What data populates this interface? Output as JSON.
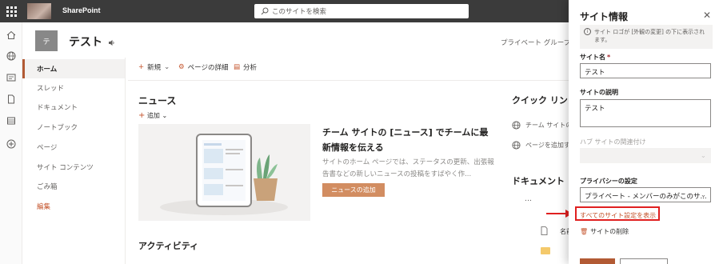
{
  "topbar": {
    "app_name": "SharePoint",
    "search_placeholder": "このサイトを検索"
  },
  "site": {
    "logo_letter": "テ",
    "title": "テスト",
    "type_label": "プライベート グループ"
  },
  "leftnav": {
    "items": [
      {
        "label": "ホーム"
      },
      {
        "label": "スレッド"
      },
      {
        "label": "ドキュメント"
      },
      {
        "label": "ノートブック"
      },
      {
        "label": "ページ"
      },
      {
        "label": "サイト コンテンツ"
      },
      {
        "label": "ごみ箱"
      },
      {
        "label": "編集"
      }
    ]
  },
  "commandbar": {
    "new_label": "新規",
    "page_details_label": "ページの詳細",
    "analytics_label": "分析"
  },
  "news": {
    "title": "ニュース",
    "add_label": "追加",
    "headline": "チーム サイトの [ニュース] でチームに最新情報を伝える",
    "body": "サイトのホーム ページでは、ステータスの更新、出張報告書などの新しいニュースの投稿をすばやく作...",
    "button_label": "ニュースの追加"
  },
  "activity": {
    "title": "アクティビティ"
  },
  "quicklinks": {
    "title": "クイック リン",
    "items": [
      {
        "label": "チーム サイトの"
      },
      {
        "label": "ページを追加す"
      }
    ]
  },
  "documents": {
    "title": "ドキュメント",
    "more": "…",
    "column_label": "名前"
  },
  "panel": {
    "title": "サイト情報",
    "info_text": "サイト ロゴが [外観の変更] の下に表示されます。",
    "site_name_label": "サイト名",
    "site_name_required": "*",
    "site_name_value": "テスト",
    "description_label": "サイトの説明",
    "description_value": "テスト",
    "hub_label": "ハブ サイトの関連付け",
    "privacy_label": "プライバシーの設定",
    "privacy_value": "プライベート - メンバーのみがこのサ...",
    "all_settings_link": "すべてのサイト設定を表示",
    "delete_label": "サイトの削除"
  }
}
